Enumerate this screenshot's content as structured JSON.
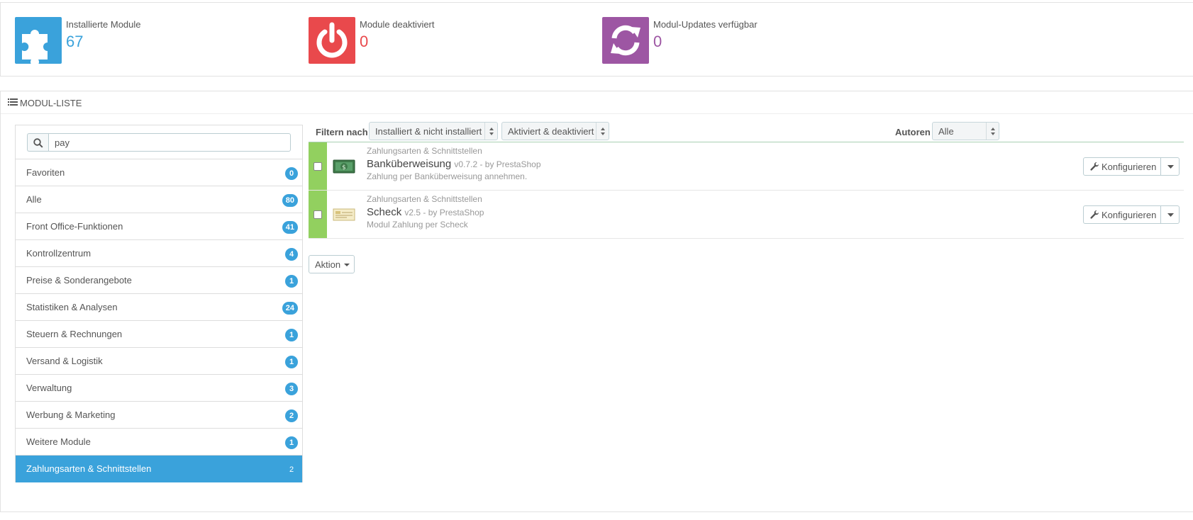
{
  "kpis": [
    {
      "label": "Installierte Module",
      "value": "67",
      "icon": "puzzle-icon",
      "color": "#3aa2db"
    },
    {
      "label": "Module deaktiviert",
      "value": "0",
      "icon": "power-icon",
      "color": "#e9494c"
    },
    {
      "label": "Modul-Updates verfügbar",
      "value": "0",
      "icon": "refresh-icon",
      "color": "#9d56a3"
    }
  ],
  "module_list": {
    "title": "MODUL-LISTE",
    "icon": "list-icon"
  },
  "search": {
    "value": "pay",
    "icon": "search-icon"
  },
  "categories": [
    {
      "name": "Favoriten",
      "count": "0"
    },
    {
      "name": "Alle",
      "count": "80"
    },
    {
      "name": "Front Office-Funktionen",
      "count": "41"
    },
    {
      "name": "Kontrollzentrum",
      "count": "4"
    },
    {
      "name": "Preise & Sonderangebote",
      "count": "1"
    },
    {
      "name": "Statistiken & Analysen",
      "count": "24"
    },
    {
      "name": "Steuern & Rechnungen",
      "count": "1"
    },
    {
      "name": "Versand & Logistik",
      "count": "1"
    },
    {
      "name": "Verwaltung",
      "count": "3"
    },
    {
      "name": "Werbung & Marketing",
      "count": "2"
    },
    {
      "name": "Weitere Module",
      "count": "1"
    },
    {
      "name": "Zahlungsarten & Schnittstellen",
      "count": "2",
      "active": true
    }
  ],
  "filters": {
    "label": "Filtern nach",
    "install_select": "Installiert & nicht installiert",
    "active_select": "Aktiviert & deaktiviert",
    "authors_label": "Autoren",
    "authors_select": "Alle"
  },
  "modules": [
    {
      "category": "Zahlungsarten & Schnittstellen",
      "name": "Banküberweisung",
      "version": "v0.7.2 - by PrestaShop",
      "description": "Zahlung per Banküberweisung annehmen.",
      "icon": "bank-transfer-icon",
      "configure_label": "Konfigurieren"
    },
    {
      "category": "Zahlungsarten & Schnittstellen",
      "name": "Scheck",
      "version": "v2.5 - by PrestaShop",
      "description": "Modul Zahlung per Scheck",
      "icon": "cheque-icon",
      "configure_label": "Konfigurieren"
    }
  ],
  "bulk_action_label": "Aktion"
}
